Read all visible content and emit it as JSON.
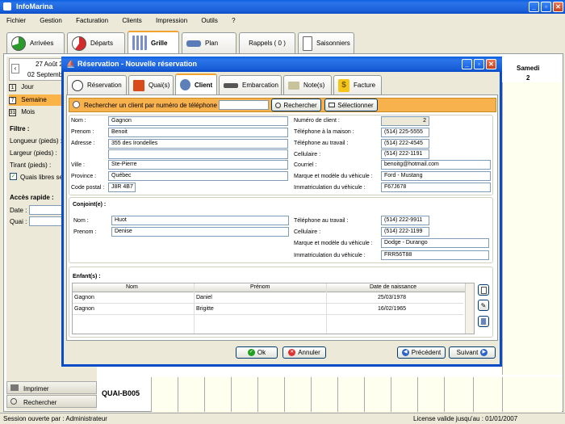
{
  "app": {
    "title": "InfoMarina"
  },
  "menu": [
    "Fichier",
    "Gestion",
    "Facturation",
    "Clients",
    "Impression",
    "Outils",
    "?"
  ],
  "main_tabs": [
    {
      "label": "Arrivées",
      "icon": "arrivals-pie-icon"
    },
    {
      "label": "Départs",
      "icon": "departures-pie-icon"
    },
    {
      "label": "Grille",
      "icon": "grid-icon"
    },
    {
      "label": "Plan",
      "icon": "boat-icon"
    },
    {
      "label": "Rappels ( 0 )",
      "icon": "calendar-icon"
    },
    {
      "label": "Saisonniers",
      "icon": "document-icon"
    }
  ],
  "left": {
    "date1": "27 Août 2",
    "date2": "02 Septembr",
    "views": [
      "Jour",
      "Semaine",
      "Mois"
    ],
    "filter_title": "Filtre :",
    "filters": [
      "Longueur (pieds) :",
      "Largeur (pieds) :",
      "Tirant (pieds) :"
    ],
    "checkbox": "Quais libres se",
    "quick_title": "Accès rapide :",
    "quick": [
      "Date :",
      "Quai :"
    ],
    "print": "Imprimer",
    "search": "Rechercher"
  },
  "calendar": {
    "day": "Samedi",
    "num": "2",
    "row_label": "QUAI-B005"
  },
  "status": {
    "left": "Session ouverte par :  Administrateur",
    "right": "License valide jusqu'au : 01/01/2007"
  },
  "dialog": {
    "title": "Réservation - Nouvelle réservation",
    "tabs": [
      "Réservation",
      "Quai(s)",
      "Client",
      "Embarcation",
      "Note(s)",
      "Facture"
    ],
    "search_label": "Rechercher un client par numéro de téléphone :",
    "search_value": "",
    "search_btn": "Rechercher",
    "select_btn": "Sélectionner",
    "client": {
      "labels": {
        "nom": "Nom :",
        "prenom": "Prenom :",
        "adresse": "Adresse :",
        "ville": "Ville :",
        "province": "Province :",
        "postal": "Code postal :",
        "numero": "Numéro de client :",
        "tel_maison": "Téléphone à la maison :",
        "tel_travail": "Téléphone au travail :",
        "cell": "Cellulaire :",
        "courriel": "Courriel :",
        "vehicule": "Marque et modèle du véhicule :",
        "immat": "Immatriculation du véhicule :"
      },
      "values": {
        "nom": "Gagnon",
        "prenom": "Benoit",
        "adresse1": "355 des Irondelles",
        "adresse2": "",
        "ville": "Ste-Pierre",
        "province": "Québec",
        "postal": "J8R 4B7",
        "numero": "2",
        "tel_maison": "(514) 225-5555",
        "tel_travail": "(514) 222-4545",
        "cell": "(514) 222-1191",
        "courriel": "benoitg@hotmail.com",
        "vehicule": "Ford - Mustang",
        "immat": "F67J678"
      }
    },
    "conjoint": {
      "title": "Conjoint(e) :",
      "labels": {
        "nom": "Nom :",
        "prenom": "Prenom :",
        "tel_travail": "Téléphone au travail :",
        "cell": "Cellulaire :",
        "vehicule": "Marque et modèle du véhicule :",
        "immat": "Immatriculation du véhicule :"
      },
      "values": {
        "nom": "Huot",
        "prenom": "Denise",
        "tel_travail": "(514) 222-9911",
        "cell": "(514) 222-1199",
        "vehicule": "Dodge - Durango",
        "immat": "FRR56T88"
      }
    },
    "enfants": {
      "title": "Enfant(s) :",
      "headers": [
        "Nom",
        "Prénom",
        "Date de naissance"
      ],
      "rows": [
        [
          "Gagnon",
          "Daniel",
          "25/03/1978"
        ],
        [
          "Gagnon",
          "Brigitte",
          "16/02/1965"
        ]
      ]
    },
    "buttons": {
      "ok": "Ok",
      "cancel": "Annuler",
      "prev": "Précédent",
      "next": "Suivant"
    }
  }
}
